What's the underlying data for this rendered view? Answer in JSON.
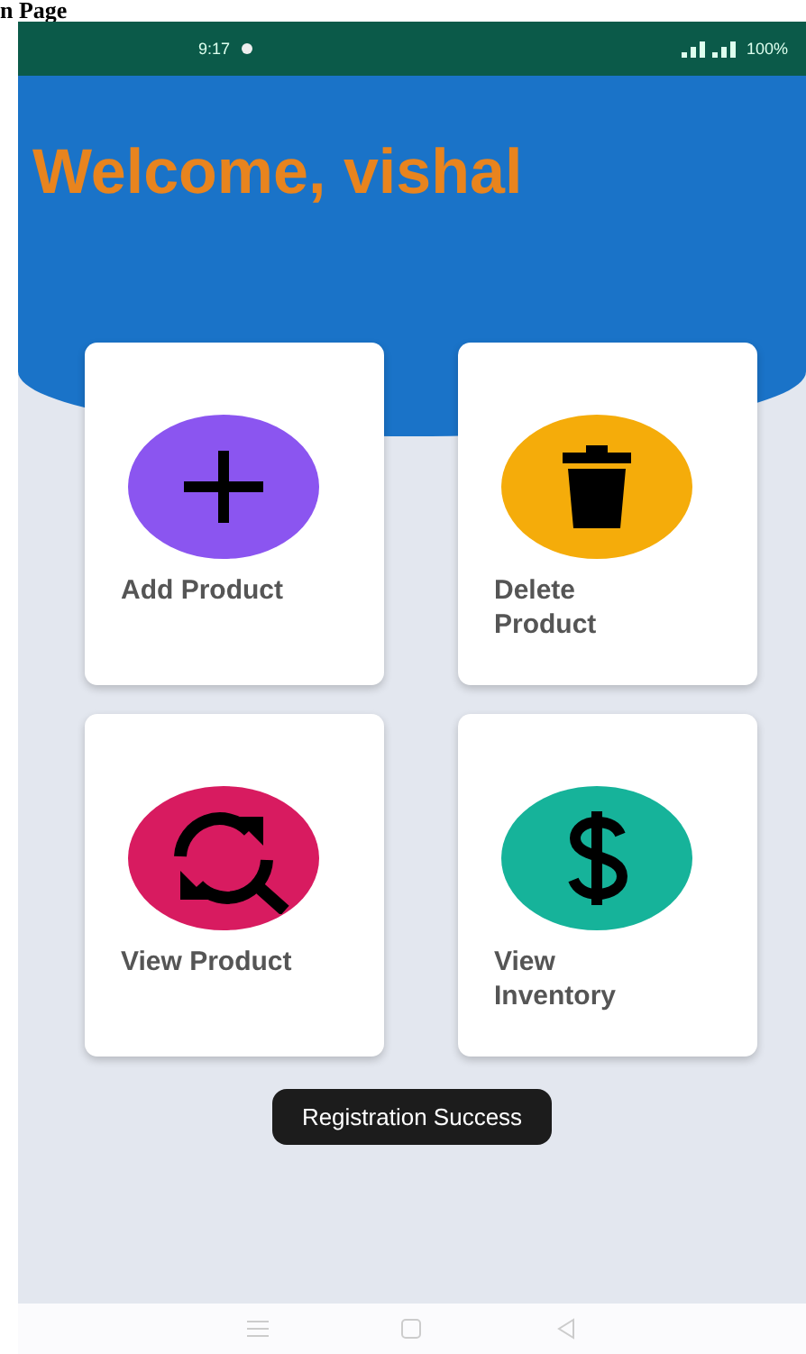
{
  "caption": "n Page",
  "status_bar": {
    "time": "9:17",
    "battery": "100%"
  },
  "welcome": "Welcome, vishal",
  "tiles": [
    {
      "label": "Add Product",
      "kind": "plus",
      "color": "#8b55f0"
    },
    {
      "label": "Delete Product",
      "kind": "trash",
      "color": "#f5ac0a"
    },
    {
      "label": "View Product",
      "kind": "refresh",
      "color": "#d81b60"
    },
    {
      "label": "View Inventory",
      "kind": "dollar",
      "color": "#16b39a"
    }
  ],
  "toast": "Registration Success"
}
